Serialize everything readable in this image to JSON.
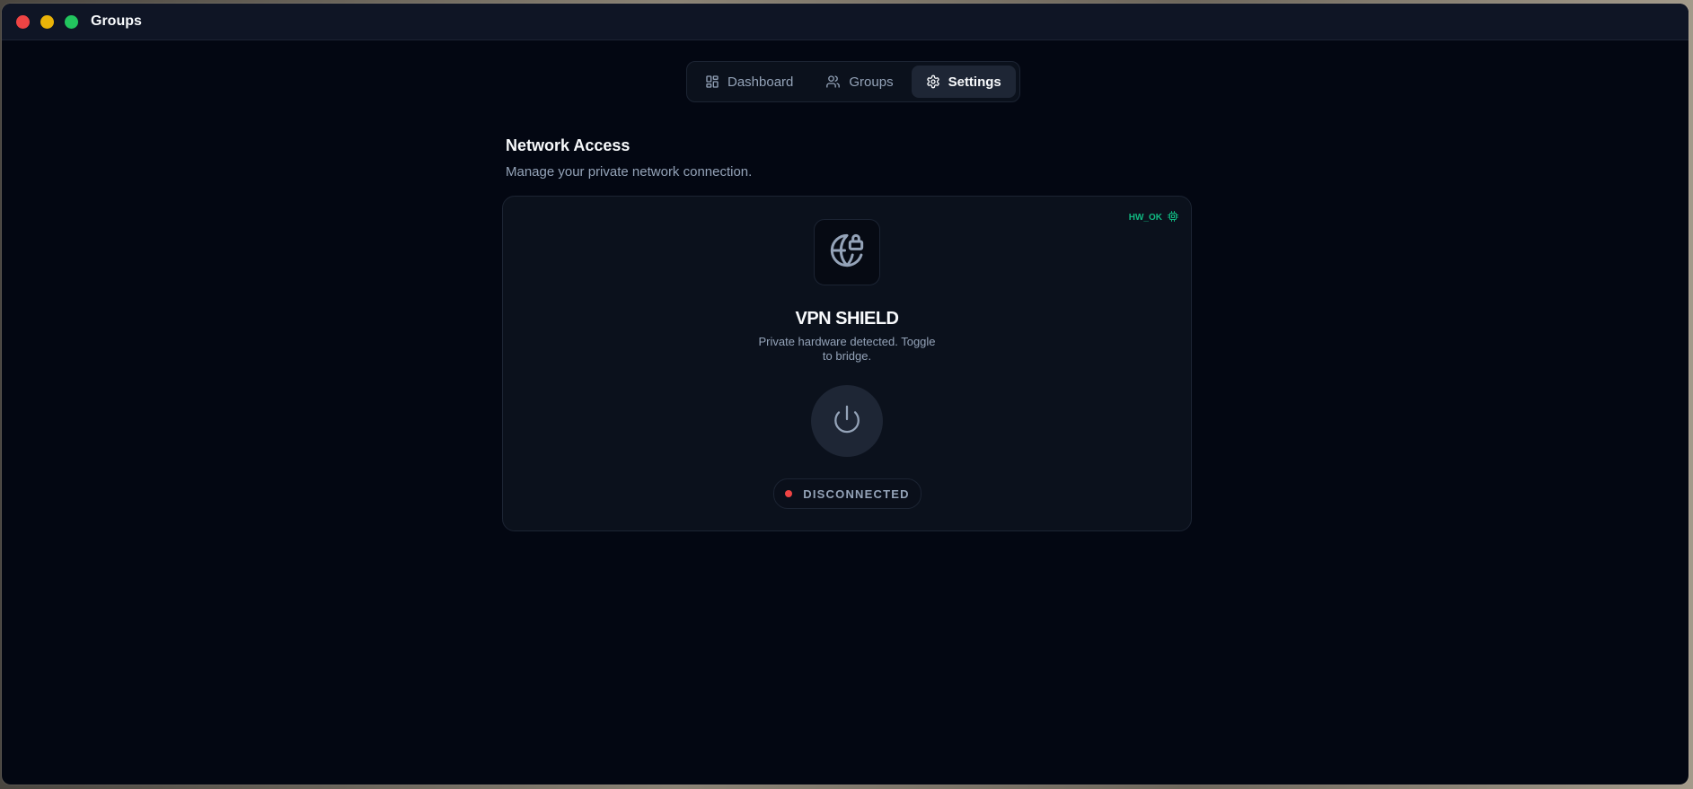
{
  "window": {
    "title": "Groups"
  },
  "nav": {
    "tabs": [
      {
        "label": "Dashboard",
        "icon": "dashboard-grid-icon",
        "active": false
      },
      {
        "label": "Groups",
        "icon": "users-icon",
        "active": false
      },
      {
        "label": "Settings",
        "icon": "gear-icon",
        "active": true
      }
    ]
  },
  "section": {
    "title": "Network Access",
    "subtitle": "Manage your private network connection."
  },
  "vpn": {
    "badge": "HW_OK",
    "badge_icon": "chip-icon",
    "icon": "globe-lock-icon",
    "title": "VPN SHIELD",
    "description": "Private hardware detected. Toggle to bridge.",
    "power_icon": "power-icon",
    "status": "DISCONNECTED",
    "status_color": "#ef4444",
    "badge_color": "#10b981"
  }
}
